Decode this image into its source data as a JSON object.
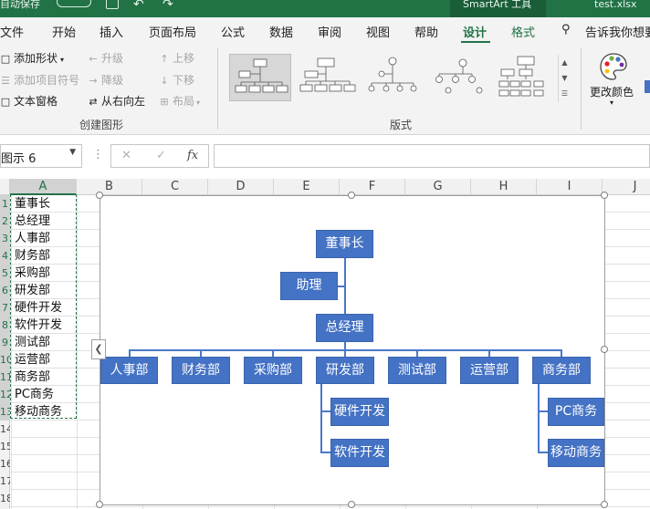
{
  "titlebar": {
    "autosave": "自动保存",
    "context_tool": "SmartArt 工具",
    "filename": "test.xlsx"
  },
  "tabs": [
    "文件",
    "开始",
    "插入",
    "页面布局",
    "公式",
    "数据",
    "审阅",
    "视图",
    "帮助",
    "设计",
    "格式"
  ],
  "active_tab": "设计",
  "tell_me": "告诉我你想要",
  "ribbon": {
    "create_group": {
      "add_shape": "添加形状",
      "add_bullet": "添加项目符号",
      "text_pane": "文本窗格",
      "promote": "升级",
      "demote": "降级",
      "right_to_left": "从右向左",
      "move_up": "上移",
      "move_down": "下移",
      "layout": "布局",
      "label": "创建图形"
    },
    "layouts_group": {
      "label": "版式"
    },
    "change_colors": "更改颜色"
  },
  "namebox": "图示 6",
  "fx_icons": {
    "cancel": "✕",
    "enter": "✓",
    "fx": "fx"
  },
  "columns": [
    "A",
    "B",
    "C",
    "D",
    "E",
    "F",
    "G",
    "H",
    "I",
    "J"
  ],
  "rows": [
    "1",
    "2",
    "3",
    "4",
    "5",
    "6",
    "7",
    "8",
    "9",
    "10",
    "11",
    "12",
    "13",
    "14",
    "15",
    "16",
    "17",
    "18"
  ],
  "cells_a": [
    "董事长",
    "总经理",
    "人事部",
    "财务部",
    "采购部",
    "研发部",
    "硬件开发",
    "软件开发",
    "测试部",
    "运营部",
    "商务部",
    "PC商务",
    "移动商务"
  ],
  "org": {
    "top": "董事长",
    "assistant": "助理",
    "manager": "总经理",
    "departments": [
      "人事部",
      "财务部",
      "采购部",
      "研发部",
      "测试部",
      "运营部",
      "商务部"
    ],
    "rd_children": [
      "硬件开发",
      "软件开发"
    ],
    "biz_children": [
      "PC商务",
      "移动商务"
    ]
  }
}
